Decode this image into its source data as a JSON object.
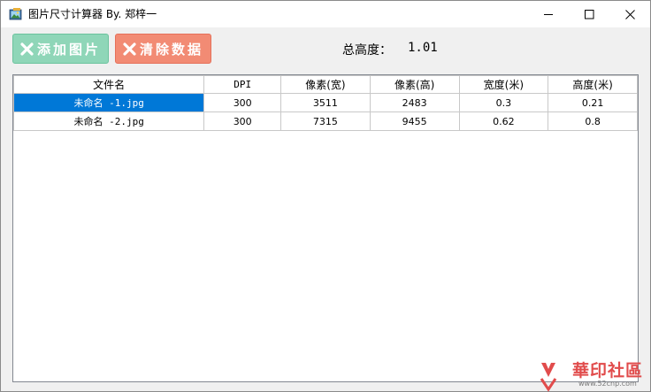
{
  "window": {
    "title": "图片尺寸计算器  By. 郑梓一",
    "icon": "app-image-icon"
  },
  "toolbar": {
    "add_label": "添加图片",
    "clear_label": "清除数据",
    "add_color": "#8fd6b8",
    "clear_color": "#f28b74"
  },
  "summary": {
    "total_label": "总高度：",
    "total_value": "1.01"
  },
  "table": {
    "headers": [
      "文件名",
      "DPI",
      "像素(宽)",
      "像素(高)",
      "宽度(米)",
      "高度(米)"
    ],
    "rows": [
      [
        "未命名 -1.jpg",
        "300",
        "3511",
        "2483",
        "0.3",
        "0.21"
      ],
      [
        "未命名 -2.jpg",
        "300",
        "7315",
        "9455",
        "0.62",
        "0.8"
      ]
    ],
    "selected_cell_color": "#0078d7"
  },
  "watermark": {
    "text": "華印社區",
    "url": "www.52cnp.com"
  }
}
